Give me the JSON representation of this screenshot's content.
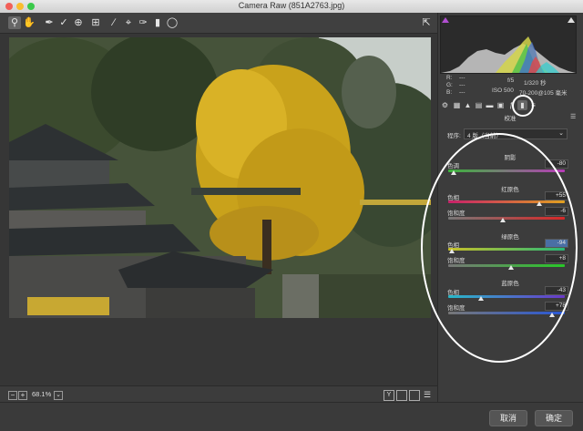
{
  "window": {
    "title": "Camera Raw (851A2763.jpg)"
  },
  "toolbar": {
    "tools": [
      "zoom-tool",
      "hand-tool",
      "white-balance-tool",
      "color-sampler-tool",
      "crop-tool",
      "straighten-tool",
      "spot-removal-tool",
      "adjustment-brush-tool",
      "graduated-filter-tool",
      "radial-filter-tool"
    ]
  },
  "bottom": {
    "zoom_level": "68.1%"
  },
  "footer": {
    "cancel_label": "取消",
    "ok_label": "确定"
  },
  "histogram": {
    "clip_shadow_color": "#b14fd1",
    "clip_highlight_color": "#e0e0e0"
  },
  "info": {
    "r_label": "R:",
    "g_label": "G:",
    "b_label": "B:",
    "r_value": "---",
    "g_value": "---",
    "b_value": "---",
    "aperture": "f/5",
    "shutter": "1/320 秒",
    "iso": "ISO 500",
    "lens": "70-200@105 毫米"
  },
  "panel": {
    "section_title": "校准",
    "process_label": "程序:",
    "process_value": "4 版（当前）",
    "shadows": {
      "title": "阴影",
      "tint_label": "色调",
      "tint_value": "-80",
      "tint_pos": 0.05
    },
    "red": {
      "title": "红原色",
      "hue_label": "色相",
      "hue_value": "+55",
      "hue_pos": 0.78,
      "sat_label": "饱和度",
      "sat_value": "-6",
      "sat_pos": 0.47
    },
    "green": {
      "title": "绿原色",
      "hue_label": "色相",
      "hue_value": "-94",
      "hue_pos": 0.03,
      "sat_label": "饱和度",
      "sat_value": "+8",
      "sat_pos": 0.54
    },
    "blue": {
      "title": "蓝原色",
      "hue_label": "色相",
      "hue_value": "-43",
      "hue_pos": 0.28,
      "sat_label": "饱和度",
      "sat_value": "+78",
      "sat_pos": 0.89
    }
  }
}
